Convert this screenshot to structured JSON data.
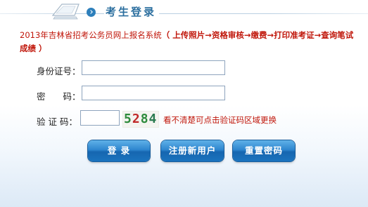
{
  "header": {
    "title": "考生登录",
    "icon": "computer-monitor-icon"
  },
  "notice": {
    "text": "2013年吉林省招考公务员网上报名系统",
    "steps": "（ 上传照片→资格审核→缴费→打印准考证→查询笔试成绩 ）"
  },
  "form": {
    "id_label": "身份证号：",
    "id_value": "",
    "password_label": "密　　码：",
    "password_value": "",
    "captcha_label": "验 证 码：",
    "captcha_value": "",
    "captcha_digits": [
      "5",
      "2",
      "8",
      "4"
    ],
    "captcha_hint": "看不清楚可点击验证码区域更换"
  },
  "buttons": {
    "login": "登 录",
    "register": "注册新用户",
    "reset": "重置密码"
  },
  "colors": {
    "notice_red": "#c0160a",
    "title_blue": "#2c6f9f",
    "button_blue": "#1f78c4"
  }
}
